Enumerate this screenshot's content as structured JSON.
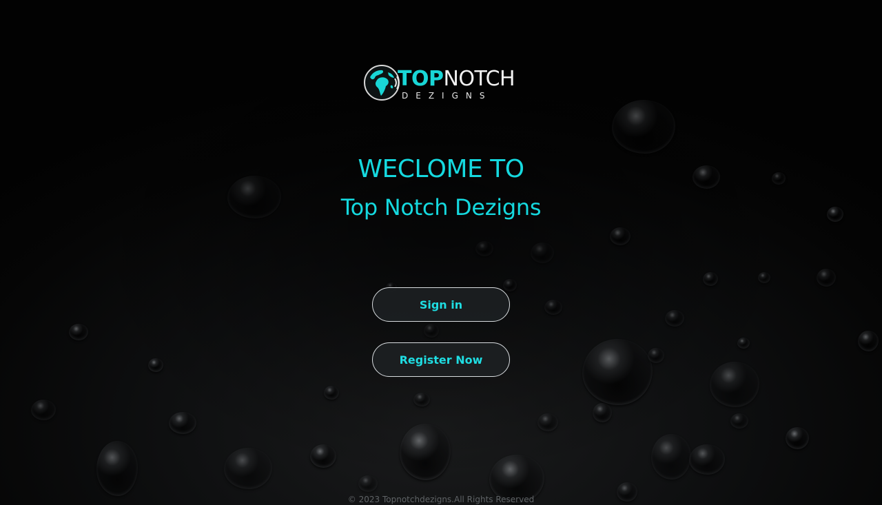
{
  "logo": {
    "word_top": "TOP",
    "word_notch": "NOTCH",
    "subtitle": "DEZIGNS",
    "icon": "globe-icon",
    "accent": "#19d6d6"
  },
  "hero": {
    "welcome": "WECLOME TO",
    "brand": "Top Notch Dezigns"
  },
  "actions": {
    "sign_in": "Sign in",
    "register": "Register Now"
  },
  "footer": {
    "copyright": "© 2023 Topnotchdezigns.All Rights Reserved"
  },
  "colors": {
    "accent": "#15d9df",
    "background": "#0b0c0d",
    "button_border": "#d9dde0"
  }
}
